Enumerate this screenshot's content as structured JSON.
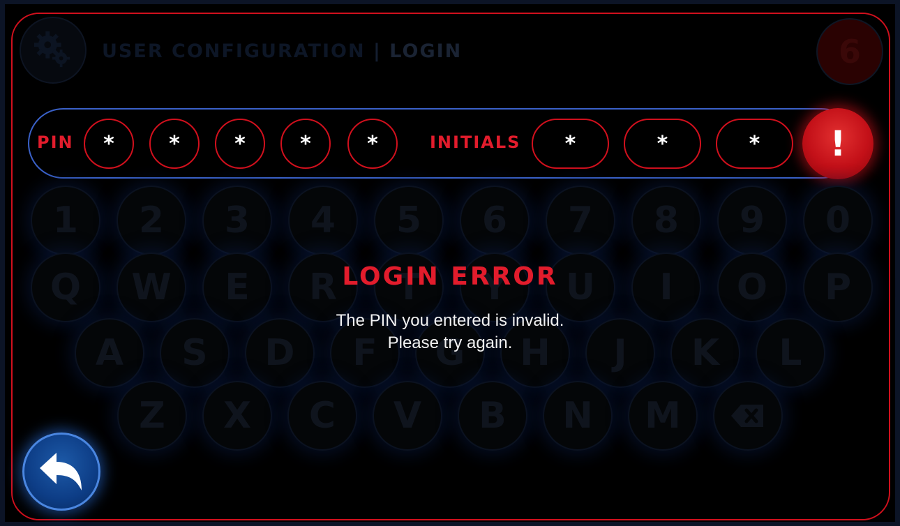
{
  "header": {
    "title_main": "USER CONFIGURATION",
    "title_separator": "|",
    "title_section": "LOGIN",
    "settings_icon": "gear-icon",
    "badge_count": "6"
  },
  "entry": {
    "pin_label": "PIN",
    "pin_slots": [
      "*",
      "*",
      "*",
      "*",
      "*"
    ],
    "initials_label": "INITIALS",
    "initials_slots": [
      "*",
      "*",
      "*"
    ],
    "alert_icon": "!"
  },
  "keyboard": {
    "row1": [
      "1",
      "2",
      "3",
      "4",
      "5",
      "6",
      "7",
      "8",
      "9",
      "0"
    ],
    "row2": [
      "Q",
      "W",
      "E",
      "R",
      "T",
      "Y",
      "U",
      "I",
      "O",
      "P"
    ],
    "row3": [
      "A",
      "S",
      "D",
      "F",
      "G",
      "H",
      "J",
      "K",
      "L"
    ],
    "row4": [
      "Z",
      "X",
      "C",
      "V",
      "B",
      "N",
      "M"
    ],
    "backspace_icon": "backspace-icon"
  },
  "dialog": {
    "title": "LOGIN ERROR",
    "message_line1": "The PIN you entered is invalid.",
    "message_line2": "Please try again."
  },
  "footer": {
    "back_icon": "back-arrow-icon"
  },
  "colors": {
    "accent_red": "#e21c2c",
    "accent_blue": "#3a61c8",
    "background": "#000000"
  }
}
